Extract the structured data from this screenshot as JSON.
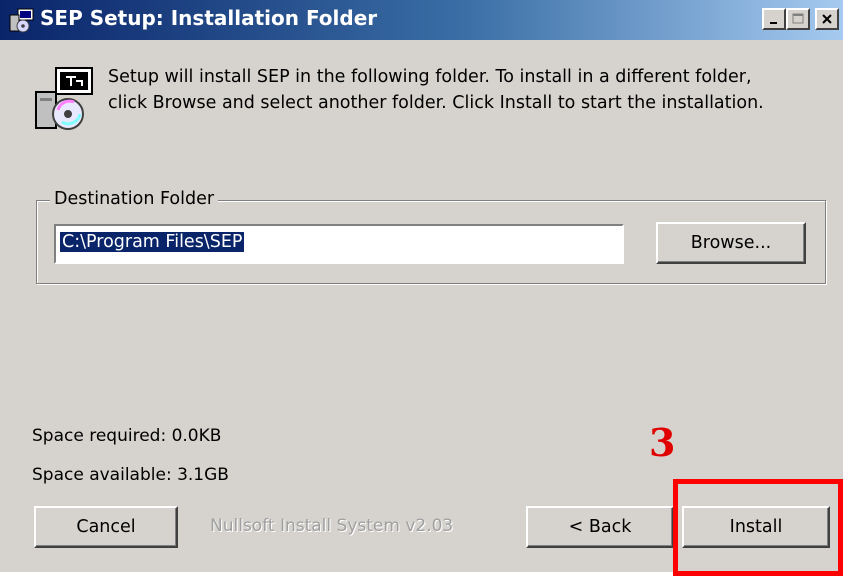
{
  "window": {
    "title": "SEP Setup: Installation Folder",
    "controls": [
      "minimize",
      "maximize",
      "close"
    ]
  },
  "intro": {
    "line1": "Setup will install SEP in the following folder. To install in a different folder,",
    "line2": "click Browse and select another folder. Click Install to start the installation."
  },
  "destination": {
    "group_label": "Destination Folder",
    "folder_value": "C:\\Program Files\\SEP",
    "browse_label": "Browse..."
  },
  "space": {
    "required": "Space required: 0.0KB",
    "available": "Space available: 3.1GB"
  },
  "footer": {
    "cancel_label": "Cancel",
    "branding": "Nullsoft Install System v2.03",
    "back_label": "< Back",
    "install_label": "Install"
  },
  "annotation": {
    "step_number": "3",
    "color": "#ff0000"
  },
  "colors": {
    "titlebar_start": "#0a246a",
    "titlebar_end": "#a6caf0",
    "face": "#d6d3ce",
    "selection": "#0a246a"
  },
  "icons": {
    "title": "installer-icon",
    "header": "installer-cd-icon"
  }
}
